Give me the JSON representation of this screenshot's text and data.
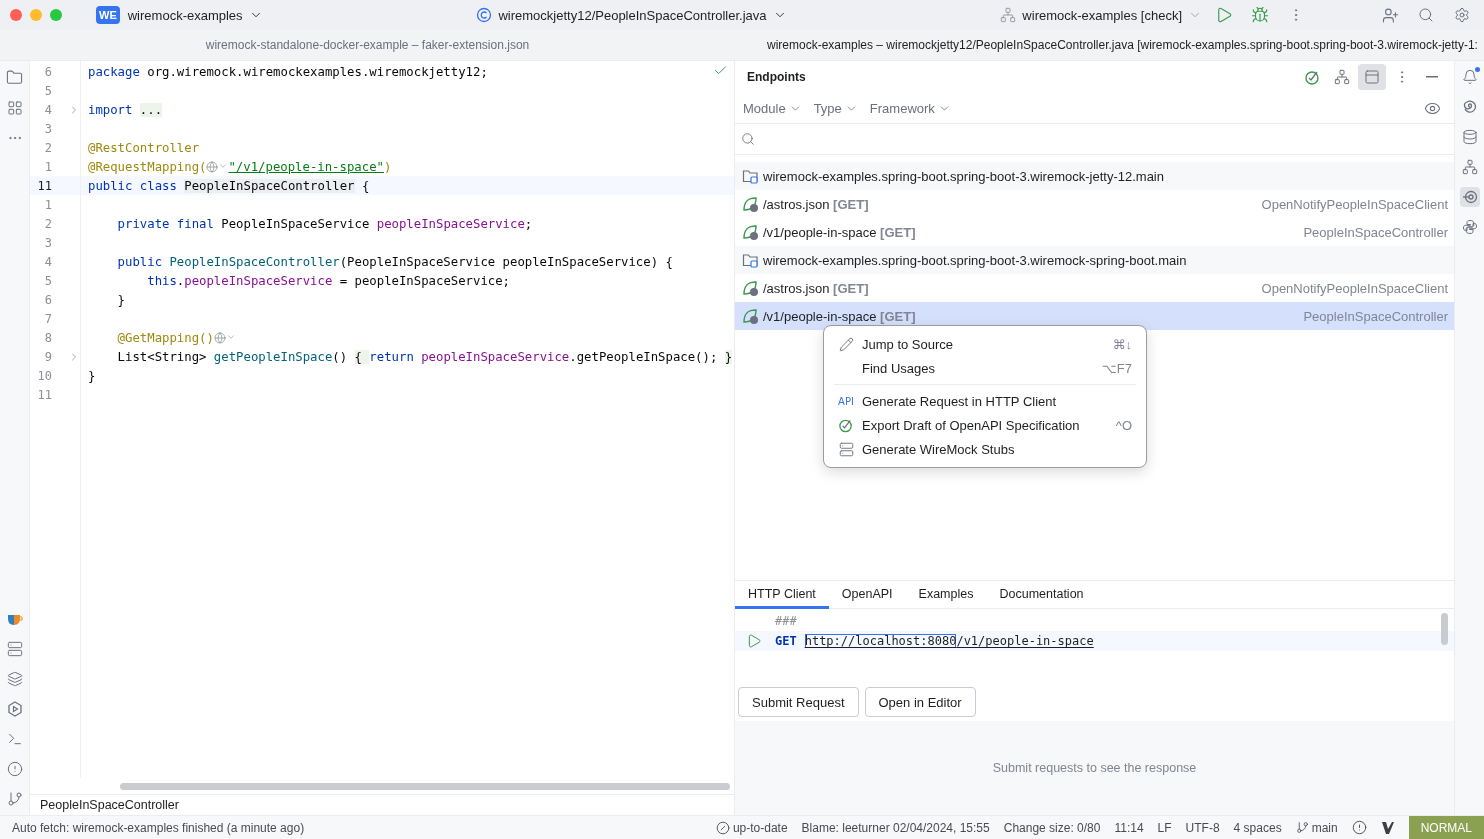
{
  "title_bar": {
    "project_badge": "WE",
    "project": "wiremock-examples",
    "file": "wiremockjetty12/PeopleInSpaceController.java",
    "run_config": "wiremock-examples [check]"
  },
  "editor_tabs": {
    "left_title": "wiremock-standalone-docker-example – faker-extension.json",
    "right_title": "wiremock-examples – wiremockjetty12/PeopleInSpaceController.java [wiremock-examples.spring-boot.spring-boot-3.wiremock-jetty-1:"
  },
  "code_lines": [
    {
      "number": "6",
      "current": false,
      "fold": false,
      "tokens": [
        {
          "kind": "kw",
          "text": "package"
        },
        {
          "kind": "plain",
          "text": " org.wiremock.wiremockexamples.wiremockjetty12;"
        }
      ]
    },
    {
      "number": "5",
      "current": false,
      "fold": false
    },
    {
      "number": "4",
      "current": false,
      "fold": true,
      "tokens": [
        {
          "kind": "kw",
          "text": "import "
        },
        {
          "kind": "folded",
          "text": "..."
        }
      ]
    },
    {
      "number": "3",
      "current": false,
      "fold": false
    },
    {
      "number": "2",
      "current": false,
      "fold": false,
      "tokens": [
        {
          "kind": "ann",
          "text": "@RestController"
        }
      ]
    },
    {
      "number": "1",
      "current": false,
      "fold": false,
      "tokens": [
        {
          "kind": "ann",
          "text": "@RequestMapping("
        },
        {
          "kind": "globe"
        },
        {
          "kind": "str",
          "text": "\"/v1/people-in-space\""
        },
        {
          "kind": "ann",
          "text": ")"
        }
      ]
    },
    {
      "number": "11",
      "current": true,
      "fold": false,
      "tokens": [
        {
          "kind": "kw",
          "text": "public class "
        },
        {
          "kind": "hl",
          "text": "PeopleInSpaceController"
        },
        {
          "kind": "plain",
          "text": " {"
        }
      ]
    },
    {
      "number": "1",
      "current": false,
      "fold": false
    },
    {
      "number": "2",
      "current": false,
      "fold": false,
      "tokens": [
        {
          "kind": "kw",
          "text": "    private final "
        },
        {
          "kind": "plain",
          "text": "PeopleInSpaceService "
        },
        {
          "kind": "field",
          "text": "peopleInSpaceService"
        },
        {
          "kind": "plain",
          "text": ";"
        }
      ]
    },
    {
      "number": "3",
      "current": false,
      "fold": false
    },
    {
      "number": "4",
      "current": false,
      "fold": false,
      "tokens": [
        {
          "kind": "kw",
          "text": "    public "
        },
        {
          "kind": "method",
          "text": "PeopleInSpaceController"
        },
        {
          "kind": "plain",
          "text": "(PeopleInSpaceService peopleInSpaceService) {"
        }
      ]
    },
    {
      "number": "5",
      "current": false,
      "fold": false,
      "tokens": [
        {
          "kind": "kw",
          "text": "        this"
        },
        {
          "kind": "plain",
          "text": "."
        },
        {
          "kind": "field",
          "text": "peopleInSpaceService"
        },
        {
          "kind": "plain",
          "text": " = peopleInSpaceService;"
        }
      ]
    },
    {
      "number": "6",
      "current": false,
      "fold": false,
      "tokens": [
        {
          "kind": "plain",
          "text": "    }"
        }
      ]
    },
    {
      "number": "7",
      "current": false,
      "fold": false
    },
    {
      "number": "8",
      "current": false,
      "fold": false,
      "tokens": [
        {
          "kind": "ann",
          "text": "    @GetMapping()"
        },
        {
          "kind": "globe"
        }
      ]
    },
    {
      "number": "9",
      "current": false,
      "fold": true,
      "tokens": [
        {
          "kind": "plain",
          "text": "    List<String> "
        },
        {
          "kind": "method",
          "text": "getPeopleInSpace"
        },
        {
          "kind": "plain",
          "text": "() "
        },
        {
          "kind": "folded",
          "text": "{ "
        },
        {
          "kind": "kw",
          "text": "return "
        },
        {
          "kind": "field",
          "text": "peopleInSpaceService"
        },
        {
          "kind": "plain",
          "text": ".getPeopleInSpace(); "
        },
        {
          "kind": "folded",
          "text": "}"
        }
      ]
    },
    {
      "number": "10",
      "current": false,
      "fold": false,
      "tokens": [
        {
          "kind": "plain",
          "text": "}"
        }
      ]
    },
    {
      "number": "11",
      "current": false,
      "fold": false
    }
  ],
  "breadcrumb": "PeopleInSpaceController",
  "endpoints": {
    "title": "Endpoints",
    "filters": [
      "Module",
      "Type",
      "Framework"
    ],
    "items": [
      {
        "kind": "group",
        "label": "wiremock-examples.spring-boot.spring-boot-3.wiremock-jetty-12.main",
        "selected": false
      },
      {
        "kind": "endpoint",
        "label": "/astros.json",
        "method": "[GET]",
        "owner": "OpenNotifyPeopleInSpaceClient",
        "selected": false
      },
      {
        "kind": "endpoint",
        "label": "/v1/people-in-space",
        "method": "[GET]",
        "owner": "PeopleInSpaceController",
        "selected": false
      },
      {
        "kind": "group",
        "label": "wiremock-examples.spring-boot.spring-boot-3.wiremock-spring-boot.main",
        "selected": false
      },
      {
        "kind": "endpoint",
        "label": "/astros.json",
        "method": "[GET]",
        "owner": "OpenNotifyPeopleInSpaceClient",
        "selected": false
      },
      {
        "kind": "endpoint",
        "label": "/v1/people-in-space",
        "method": "[GET]",
        "owner": "PeopleInSpaceController",
        "selected": true
      }
    ]
  },
  "context_menu": [
    {
      "kind": "item",
      "label": "Jump to Source",
      "shortcut": "⌘↓"
    },
    {
      "kind": "item",
      "label": "Find Usages",
      "shortcut": "⌥F7"
    },
    {
      "kind": "separator"
    },
    {
      "kind": "item",
      "label": "Generate Request in HTTP Client",
      "badge": "API"
    },
    {
      "kind": "item",
      "label": "Export Draft of OpenAPI Specification",
      "shortcut": "^O"
    },
    {
      "kind": "item",
      "label": "Generate WireMock Stubs"
    }
  ],
  "detail_tabs": [
    {
      "label": "HTTP Client",
      "selected": true
    },
    {
      "label": "OpenAPI",
      "selected": false
    },
    {
      "label": "Examples",
      "selected": false
    },
    {
      "label": "Documentation",
      "selected": false
    }
  ],
  "http_client": {
    "comment": "###",
    "method": "GET",
    "host": "http://localhost:8080",
    "path": "/v1/people-in-space"
  },
  "buttons": [
    "Submit Request",
    "Open in Editor"
  ],
  "response_hint": "Submit requests to see the response",
  "status_bar": {
    "message": "Auto fetch: wiremock-examples finished (a minute ago)",
    "vcs_state": "up-to-date",
    "blame": "Blame: leeturner 02/04/2024, 15:55",
    "change_size": "Change size: 0/80",
    "position": "11:14",
    "line_ending": "LF",
    "encoding": "UTF-8",
    "indent": "4 spaces",
    "branch": "main",
    "mode": "NORMAL"
  }
}
